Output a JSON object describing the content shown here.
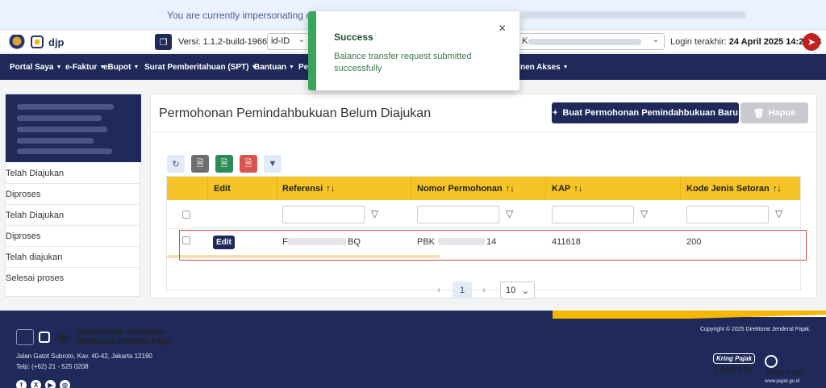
{
  "impersonation": {
    "text": "You are currently impersonating user:"
  },
  "header": {
    "brand": "djp",
    "version_text": "Versi:  1.1.2-build-1966",
    "language": "id-ID",
    "account_prefix": "K",
    "last_login_label": "Login terakhir:",
    "last_login_value": "24 April 2025 14:29:24"
  },
  "nav": {
    "items": [
      "Portal Saya",
      "e-Faktur",
      "eBupot",
      "Surat Pemberitahuan (SPT)",
      "Bantuan",
      "Pe",
      "nen Akses"
    ]
  },
  "sidebar": {
    "items": [
      "Telah Diajukan",
      "Diproses",
      "Telah Diajukan",
      "Diproses",
      "Telah diajukan",
      "Selesai proses"
    ]
  },
  "main": {
    "title": "Permohonan Pemindahbukuan Belum Diajukan",
    "new_button": "Buat Permohonan Pemindahbukuan Baru",
    "delete_button": "Hapus",
    "columns": {
      "edit": "Edit",
      "referensi": "Referensi",
      "nomor": "Nomor Permohonan",
      "kap": "KAP",
      "kode": "Kode Jenis Setoran"
    },
    "sort_glyph": "↑↓",
    "row": {
      "edit_label": "Edit",
      "ref_start": "F",
      "ref_end": "BQ",
      "nomor_start": "PBK",
      "nomor_end": "14",
      "kap": "411618",
      "kode": "200"
    },
    "scroll_fraction": 0.43,
    "pager": {
      "prev": "‹",
      "page": "1",
      "next": "›",
      "size": "10"
    }
  },
  "toast": {
    "title": "Success",
    "message": "Balance transfer request submitted successfully",
    "close": "×"
  },
  "footer": {
    "brand": "djp",
    "org_line1": "Kementerian Keuangan",
    "org_line2": "Direktorat Jenderal Pajak",
    "address": "Jalan Gatot Subroto, Kav. 40-42, Jakarta 12190",
    "phone": "Telp: (+62) 21 - 525 0208",
    "copyright": "Copyright © 2025 Direktorat Jenderal Pajak.",
    "kring_label": "Kring Pajak",
    "kring_number": "1 500 200",
    "situs_label": "Situs Pajak",
    "situs_url": "www.pajak.go.id",
    "social": [
      "f",
      "X",
      "▶",
      "◎"
    ]
  },
  "colors": {
    "navy": "#1f2a5a",
    "accent_yellow": "#f5c427",
    "success_green": "#3aa55a",
    "danger_red": "#c0211f"
  }
}
